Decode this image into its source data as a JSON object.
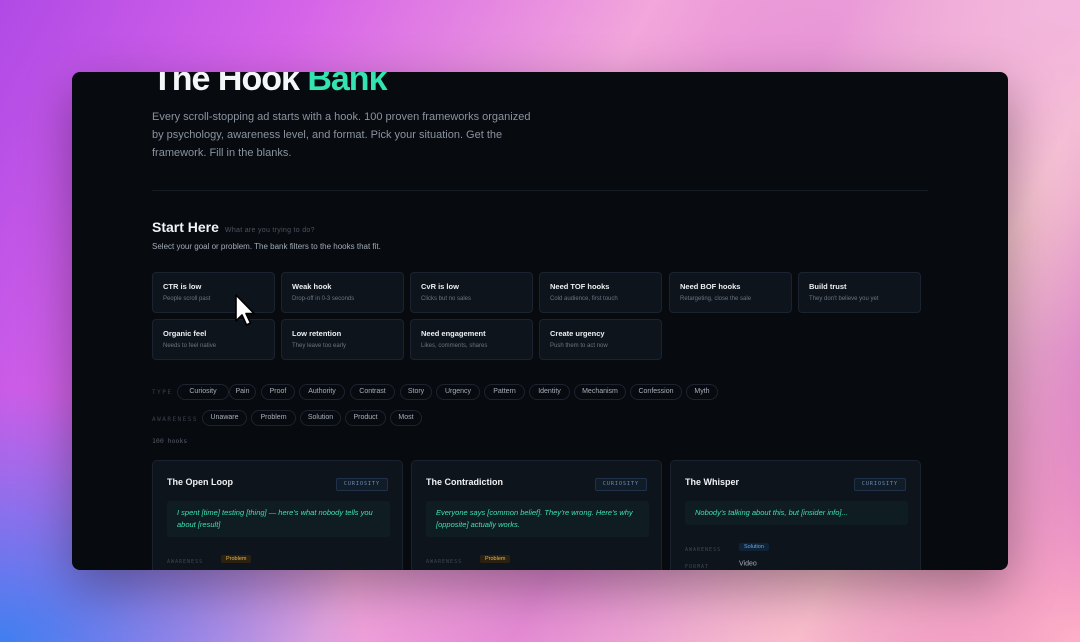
{
  "hero": {
    "title_prefix": "The Hook ",
    "title_accent": "Bank",
    "intro": "Every scroll-stopping ad starts with a hook. 100 proven frameworks organized by psychology, awareness level, and format. Pick your situation. Get the framework. Fill in the blanks."
  },
  "start": {
    "title": "Start Here",
    "hint": "What are you trying to do?",
    "description": "Select your goal or problem. The bank filters to the hooks that fit."
  },
  "goals": [
    {
      "title": "CTR is low",
      "sub": "People scroll past"
    },
    {
      "title": "Weak hook",
      "sub": "Drop-off in 0-3 seconds"
    },
    {
      "title": "CvR is low",
      "sub": "Clicks but no sales"
    },
    {
      "title": "Need TOF hooks",
      "sub": "Cold audience, first touch"
    },
    {
      "title": "Need BOF hooks",
      "sub": "Retargeting, close the sale"
    },
    {
      "title": "Build trust",
      "sub": "They don't believe you yet"
    },
    {
      "title": "Organic feel",
      "sub": "Needs to feel native"
    },
    {
      "title": "Low retention",
      "sub": "They leave too early"
    },
    {
      "title": "Need engagement",
      "sub": "Likes, comments, shares"
    },
    {
      "title": "Create urgency",
      "sub": "Push them to act now"
    }
  ],
  "filters": {
    "type_label": "TYPE",
    "type_options": [
      "Curiosity",
      "Pain",
      "Proof",
      "Authority",
      "Contrast",
      "Story",
      "Urgency",
      "Pattern",
      "Identity",
      "Mechanism",
      "Confession",
      "Myth"
    ],
    "awareness_label": "AWARENESS",
    "awareness_options": [
      "Unaware",
      "Problem",
      "Solution",
      "Product",
      "Most"
    ]
  },
  "count_label": "100 hooks",
  "hooks": [
    {
      "title": "The Open Loop",
      "tag": "CURIOSITY",
      "body": "I spent [time] testing [thing] — here's what nobody tells you about [result]",
      "awareness_label": "AWARENESS",
      "awareness": "Problem"
    },
    {
      "title": "The Contradiction",
      "tag": "CURIOSITY",
      "body": "Everyone says [common belief]. They're wrong. Here's why [opposite] actually works.",
      "awareness_label": "AWARENESS",
      "awareness": "Problem"
    },
    {
      "title": "The Whisper",
      "tag": "CURIOSITY",
      "body": "Nobody's talking about this, but [insider info]...",
      "awareness_label": "AWARENESS",
      "awareness": "Solution",
      "format_label": "FORMAT",
      "format": "Video"
    }
  ],
  "colors": {
    "accent": "#33e3b2",
    "window_bg": "#070a0f",
    "card_bg": "#0e141c",
    "problem_badge": "#e9b44d",
    "solution_badge": "#62a8f0"
  }
}
